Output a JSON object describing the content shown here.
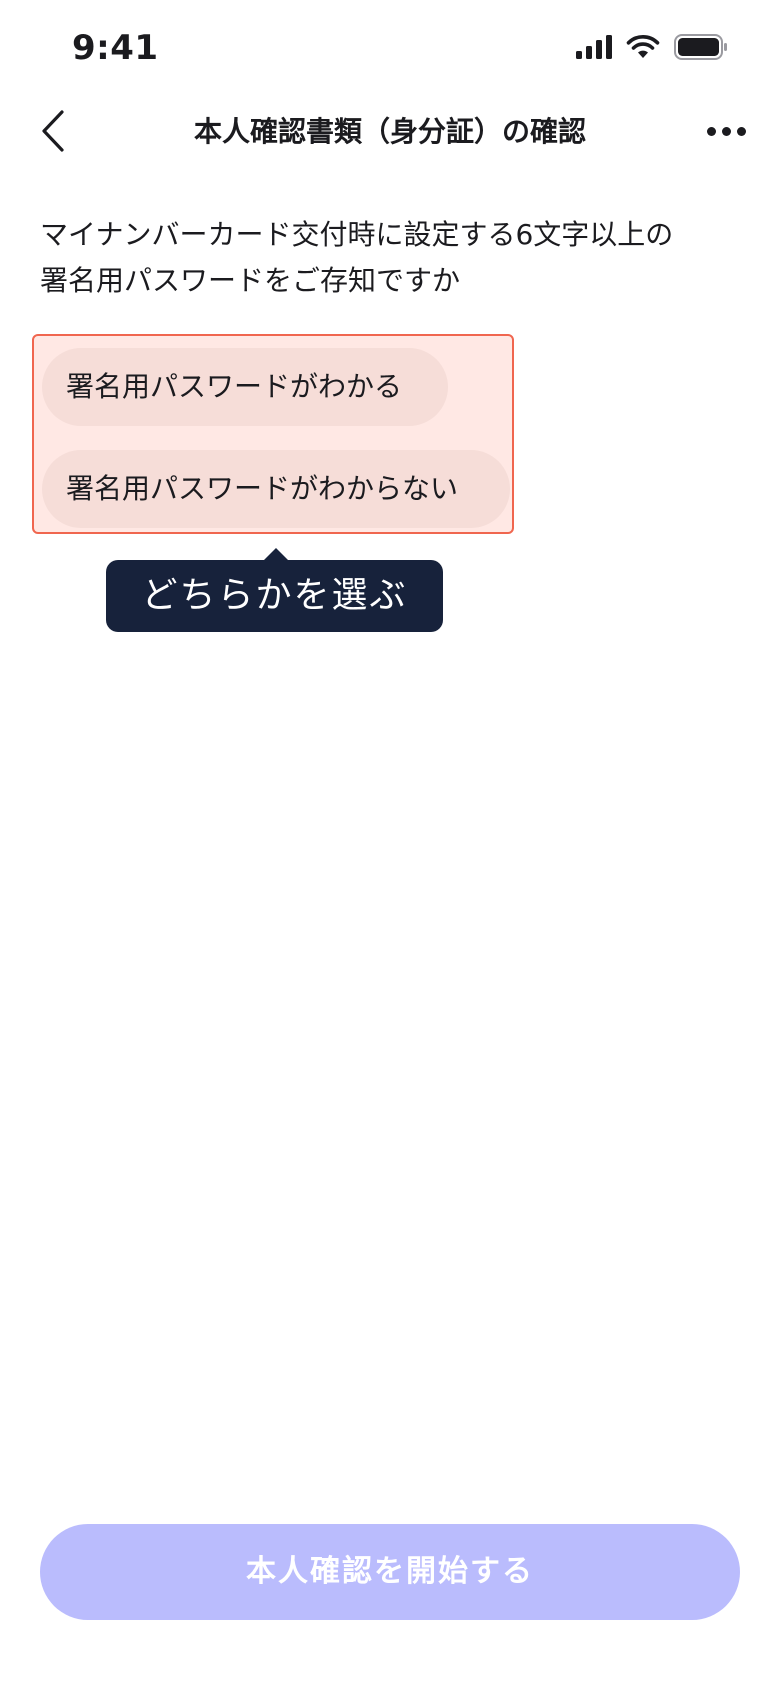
{
  "status_bar": {
    "time": "9:41",
    "icons": [
      "cellular-signal-icon",
      "wifi-icon",
      "battery-icon"
    ]
  },
  "nav": {
    "title": "本人確認書類（身分証）の確認",
    "back_icon": "chevron-left-icon",
    "more_icon": "more-horizontal-icon"
  },
  "question": {
    "line1": "マイナンバーカード交付時に設定する6文字以上の",
    "line2": "署名用パスワードをご存知ですか"
  },
  "options": [
    {
      "label": "署名用パスワードがわかる"
    },
    {
      "label": "署名用パスワードがわからない"
    }
  ],
  "tooltip": {
    "text": "どちらかを選ぶ"
  },
  "footer": {
    "start_label": "本人確認を開始する"
  },
  "colors": {
    "highlight_border": "#f0664f",
    "highlight_fill": "#ffe8e4",
    "option_bg": "#f6ddd8",
    "tooltip_bg": "#17223b",
    "button_disabled_bg": "#babcfd"
  }
}
